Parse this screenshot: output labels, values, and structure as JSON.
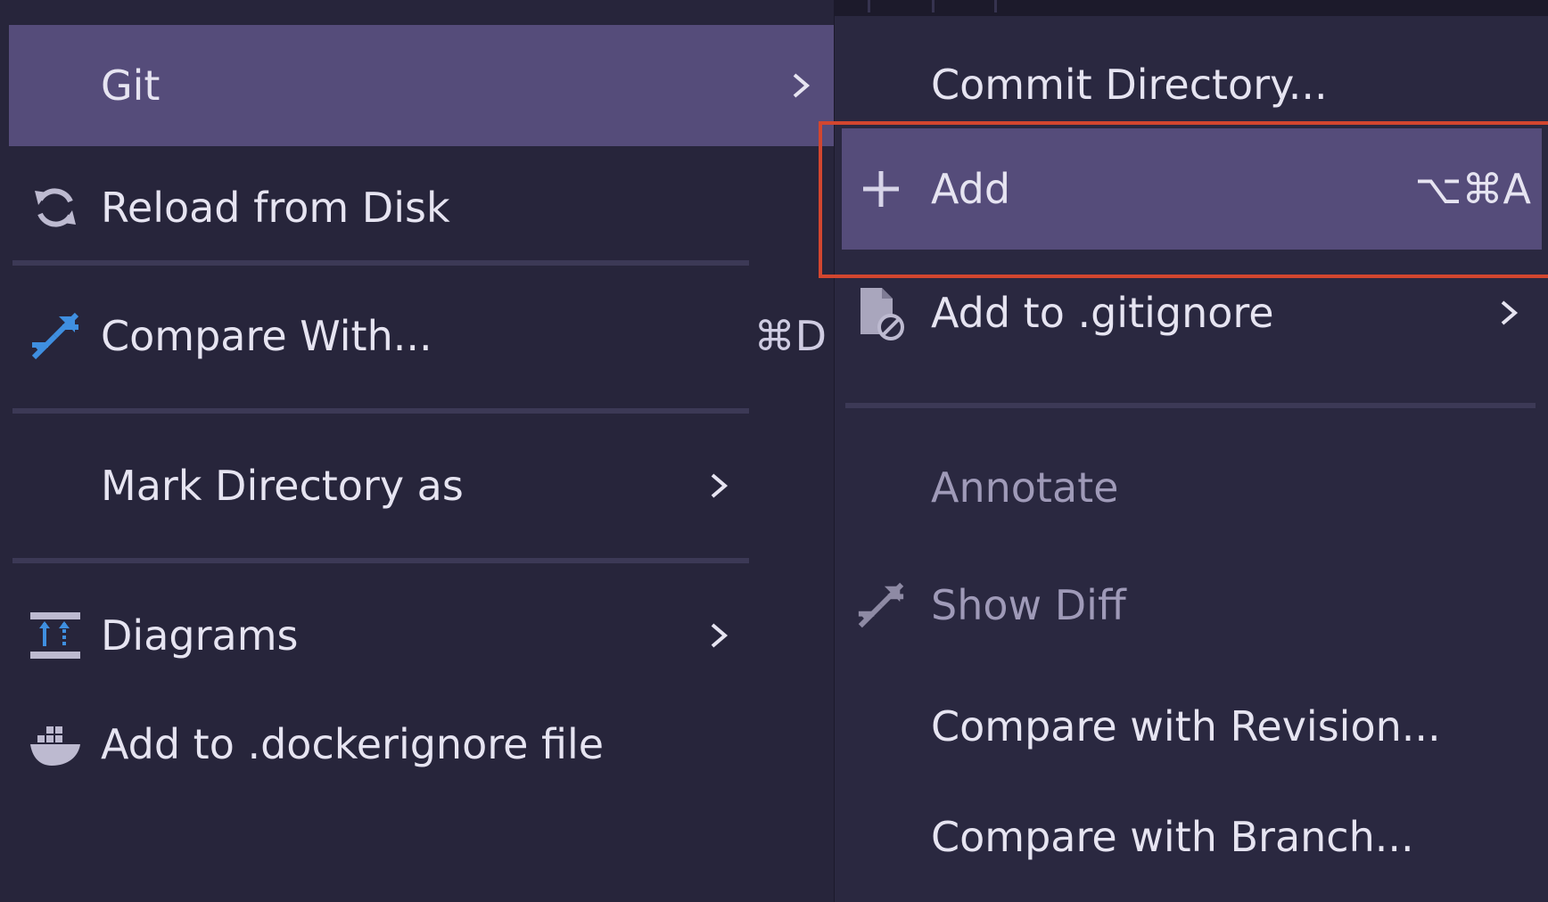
{
  "main_menu": {
    "git": {
      "label": "Git",
      "icon": "chevron-right-icon"
    },
    "reload": {
      "label": "Reload from Disk",
      "icon": "reload-icon"
    },
    "compare": {
      "label": "Compare With...",
      "shortcut": "⌘D",
      "icon": "compare-arrows-icon"
    },
    "mark_directory": {
      "label": "Mark Directory as",
      "icon": "chevron-right-icon"
    },
    "diagrams": {
      "label": "Diagrams",
      "icon": "diagram-icon"
    },
    "dockerignore": {
      "label": "Add to .dockerignore file",
      "icon": "docker-icon"
    }
  },
  "git_submenu": {
    "commit_directory": {
      "label": "Commit Directory..."
    },
    "add": {
      "label": "Add",
      "shortcut": "⌥⌘A",
      "icon": "plus-icon"
    },
    "gitignore": {
      "label": "Add to .gitignore",
      "icon": "ignore-file-icon"
    },
    "annotate": {
      "label": "Annotate",
      "disabled": true
    },
    "show_diff": {
      "label": "Show Diff",
      "disabled": true,
      "icon": "compare-arrows-icon"
    },
    "compare_revision": {
      "label": "Compare with Revision..."
    },
    "compare_branch": {
      "label": "Compare with Branch..."
    }
  },
  "colors": {
    "menu_bg": "#27253b",
    "selected_bg": "#554c7a",
    "highlight_border": "#d2462f",
    "accent_blue": "#3f8fe0"
  }
}
